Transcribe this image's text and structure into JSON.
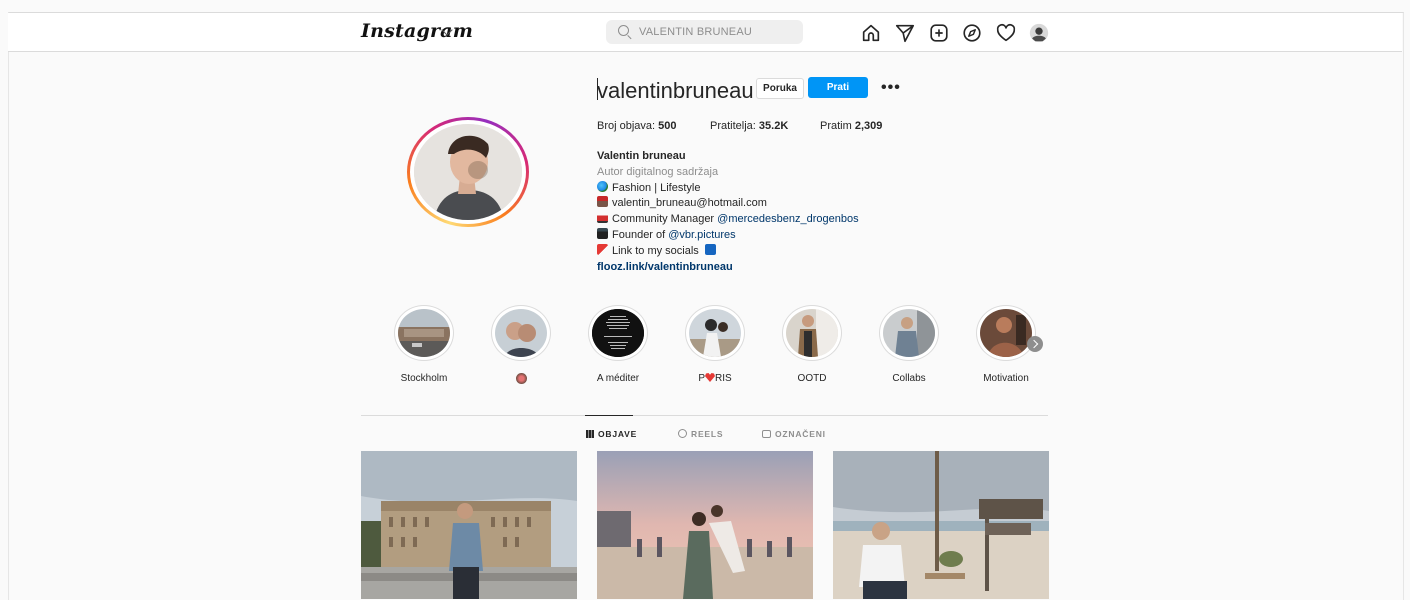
{
  "header": {
    "logo": "Instagram",
    "search_placeholder": "VALENTIN BRUNEAU",
    "nav_icons": [
      "home-icon",
      "direct-icon",
      "new-post-icon",
      "explore-icon",
      "activity-heart-icon",
      "profile-avatar-icon"
    ]
  },
  "profile": {
    "username": "valentinbruneau",
    "message_label": "Poruka",
    "follow_label": "Prati",
    "more_label": "•••",
    "stats": {
      "posts_label": "Broj objava:",
      "posts_value": "500",
      "followers_label": "Pratitelja:",
      "followers_value": "35.2K",
      "following_label": "Pratim",
      "following_value": "2,309"
    },
    "bio": {
      "name": "Valentin bruneau",
      "category": "Autor digitalnog sadržaja",
      "line1": "Fashion | Lifestyle",
      "line2": "valentin_bruneau@hotmail.com",
      "line3_text": "Community Manager ",
      "line3_mention": "@mercedesbenz_drogenbos",
      "line4_text": "Founder of ",
      "line4_mention": "@vbr.pictures",
      "line5": "Link to my socials",
      "external_link": "flooz.link/valentinbruneau"
    }
  },
  "highlights": [
    {
      "label": "Stockholm"
    },
    {
      "label": ""
    },
    {
      "label": "A méditer"
    },
    {
      "label_before": "P",
      "label_after": "RIS"
    },
    {
      "label": "OOTD"
    },
    {
      "label": "Collabs"
    },
    {
      "label": "Motivation"
    }
  ],
  "tabs": [
    {
      "label": "OBJAVE",
      "active": true
    },
    {
      "label": "REELS",
      "active": false
    },
    {
      "label": "OZNAČENI",
      "active": false
    }
  ],
  "posts_count_visible": 3,
  "colors": {
    "accent": "#0095f6",
    "link": "#00376b",
    "muted": "#8e8e8e",
    "border": "#dbdbdb",
    "background": "#fafafa"
  }
}
